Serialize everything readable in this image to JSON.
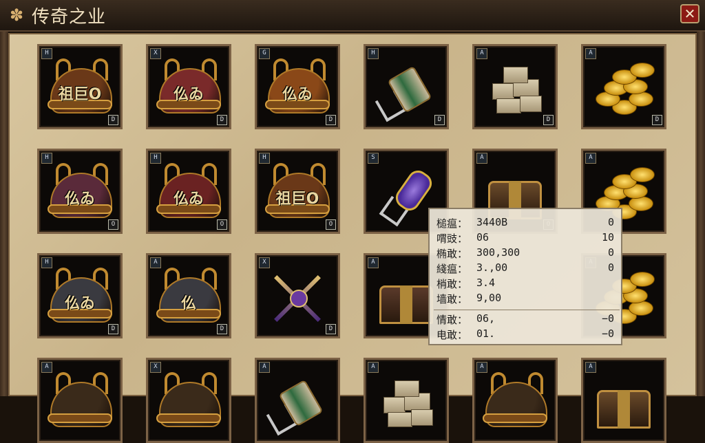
{
  "window": {
    "title": "传奇之业",
    "title_icon": "fan-icon",
    "close_icon": "close-icon",
    "close_glyph": "✕"
  },
  "inventory": {
    "slots": [
      {
        "tl": "H",
        "br": "D",
        "kind": "helmet",
        "color": "#6a3818",
        "text": "祖巨O"
      },
      {
        "tl": "X",
        "br": "D",
        "kind": "helmet",
        "color": "#7a2a2a",
        "text": "仫ゐ"
      },
      {
        "tl": "G",
        "br": "D",
        "kind": "helmet",
        "color": "#8a4818",
        "text": "仫ゐ"
      },
      {
        "tl": "H",
        "br": "D",
        "kind": "bag",
        "color": "#2e6a3e",
        "text": ""
      },
      {
        "tl": "A",
        "br": "D",
        "kind": "stone",
        "color": "#a89878",
        "text": ""
      },
      {
        "tl": "A",
        "br": "D",
        "kind": "coins",
        "color": "#d8a820",
        "text": ""
      },
      {
        "tl": "H",
        "br": "O",
        "kind": "helmet",
        "color": "#5a2a3a",
        "text": "仫ゐ"
      },
      {
        "tl": "H",
        "br": "O",
        "kind": "helmet",
        "color": "#6a2222",
        "text": "仫ゐ"
      },
      {
        "tl": "H",
        "br": "O",
        "kind": "helmet",
        "color": "#6a3818",
        "text": "祖巨O"
      },
      {
        "tl": "S",
        "br": "",
        "kind": "vial",
        "color": "#4a2a9a",
        "text": ""
      },
      {
        "tl": "A",
        "br": "O",
        "kind": "chest",
        "color": "#6a4a2a",
        "text": ""
      },
      {
        "tl": "A",
        "br": "",
        "kind": "coins",
        "color": "#d8a820",
        "text": ""
      },
      {
        "tl": "H",
        "br": "D",
        "kind": "helmet",
        "color": "#3a3a40",
        "text": "仫ゐ"
      },
      {
        "tl": "A",
        "br": "D",
        "kind": "helmet",
        "color": "#3a3a40",
        "text": "仫"
      },
      {
        "tl": "X",
        "br": "D",
        "kind": "staff",
        "color": "#4a2a7a",
        "text": ""
      },
      {
        "tl": "A",
        "br": "",
        "kind": "chest",
        "color": "#5a3a2a",
        "text": ""
      },
      {
        "tl": "",
        "br": "",
        "kind": "empty",
        "color": "#000000",
        "text": ""
      },
      {
        "tl": "A",
        "br": "",
        "kind": "coins",
        "color": "#d8a820",
        "text": ""
      },
      {
        "tl": "A",
        "br": "",
        "kind": "helmet",
        "color": "#3a2a1a",
        "text": ""
      },
      {
        "tl": "X",
        "br": "",
        "kind": "helmet",
        "color": "#3a2a1a",
        "text": ""
      },
      {
        "tl": "A",
        "br": "",
        "kind": "bag",
        "color": "#2e6a3e",
        "text": ""
      },
      {
        "tl": "A",
        "br": "",
        "kind": "stone",
        "color": "#a89878",
        "text": ""
      },
      {
        "tl": "A",
        "br": "",
        "kind": "helmet",
        "color": "#3a2a1a",
        "text": ""
      },
      {
        "tl": "A",
        "br": "",
        "kind": "chest",
        "color": "#6a4a2a",
        "text": ""
      }
    ]
  },
  "tooltip": {
    "rows": [
      {
        "label": "槌瘟：",
        "value": "3440B",
        "right": "0"
      },
      {
        "label": "喟豉：",
        "value": "06",
        "right": "10"
      },
      {
        "label": "椭敢：",
        "value": "300,300",
        "right": "0"
      },
      {
        "label": "綫瘟：",
        "value": "3.,00",
        "right": "0"
      },
      {
        "label": "梢敢：",
        "value": "3.4",
        "right": ""
      },
      {
        "label": "墙敢：",
        "value": "9,00",
        "right": ""
      },
      {
        "label": "情敢：",
        "value": "06,",
        "right": "−0"
      },
      {
        "label": "电敢：",
        "value": "01.",
        "right": "−0"
      }
    ]
  }
}
